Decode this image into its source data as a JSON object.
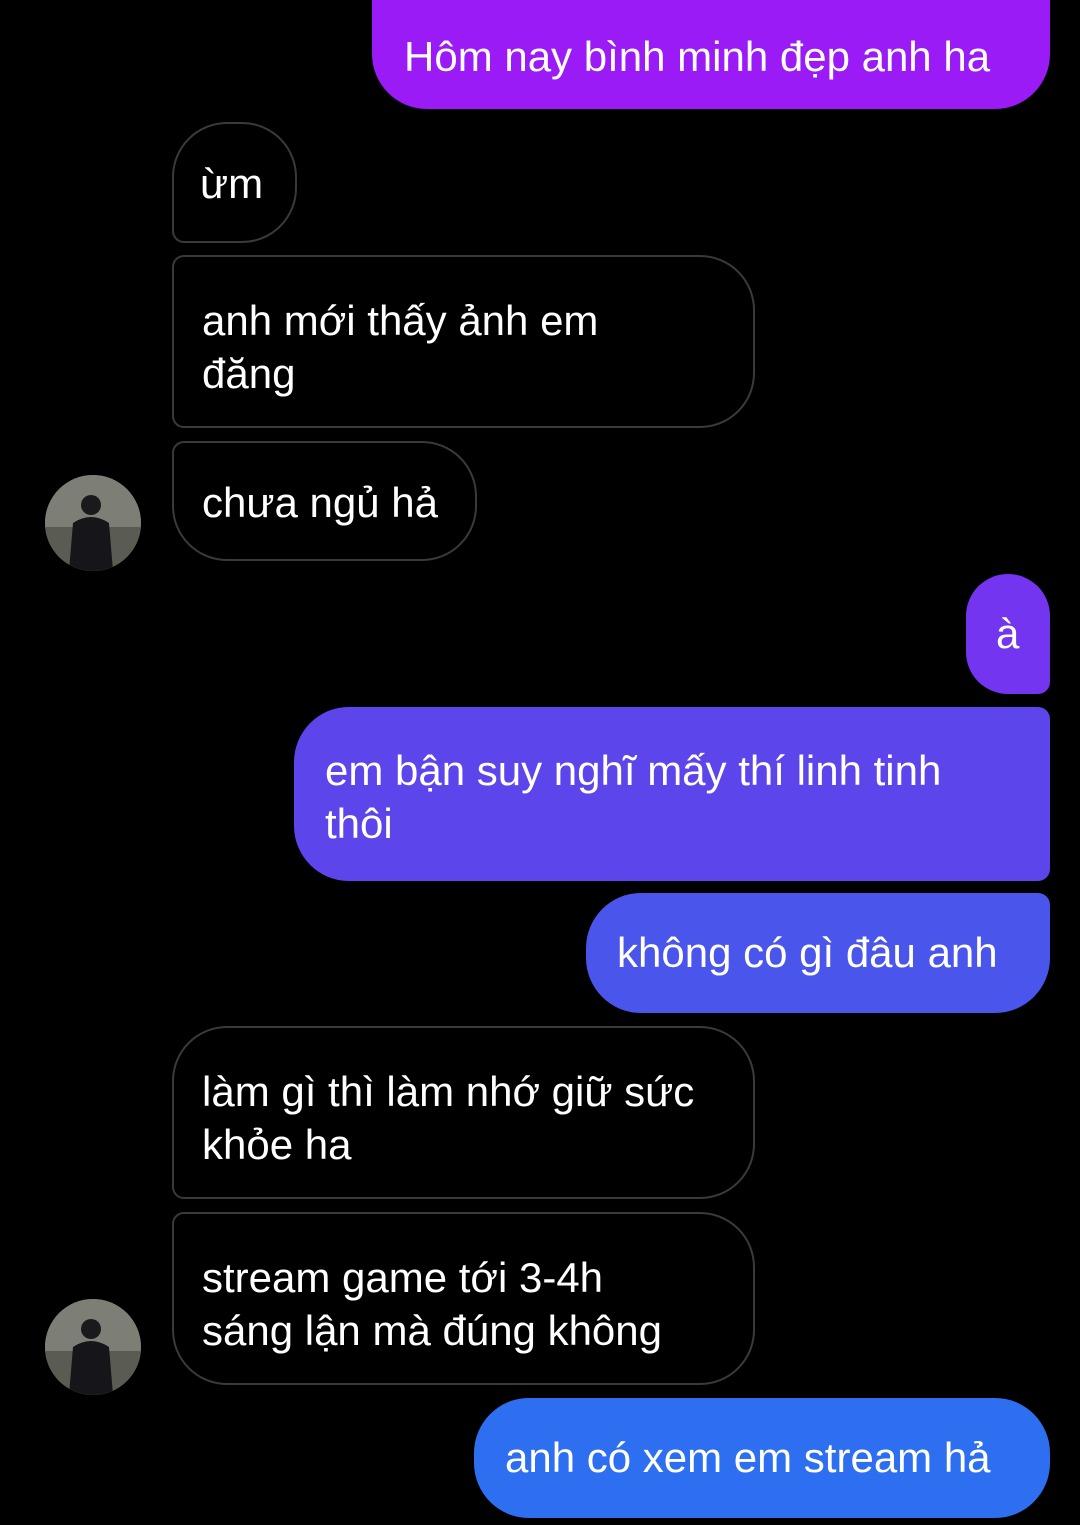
{
  "colors": {
    "background": "#000000",
    "incoming_border": "#3a3a3a",
    "outgoing_purple": "#9a1bf5",
    "outgoing_violet": "#7335ef",
    "outgoing_indigo": "#5c45ea",
    "outgoing_blue": "#2d6ff0"
  },
  "messages": [
    {
      "sender": "me",
      "text": "Hôm nay bình minh đẹp anh ha"
    },
    {
      "sender": "them",
      "text": "ừm"
    },
    {
      "sender": "them",
      "text": "anh mới thấy ảnh em đăng"
    },
    {
      "sender": "them",
      "text": "chưa ngủ hả"
    },
    {
      "sender": "me",
      "text": "à"
    },
    {
      "sender": "me",
      "text": "em bận suy nghĩ mấy thí linh tinh thôi"
    },
    {
      "sender": "me",
      "text": "không có gì đâu anh"
    },
    {
      "sender": "them",
      "text": "làm gì thì làm nhớ giữ sức khỏe ha"
    },
    {
      "sender": "them",
      "text": "stream game tới 3-4h sáng lận mà đúng không"
    },
    {
      "sender": "me",
      "text": "anh có xem em stream hả"
    }
  ],
  "avatar": {
    "icon": "contact-avatar-photo"
  }
}
